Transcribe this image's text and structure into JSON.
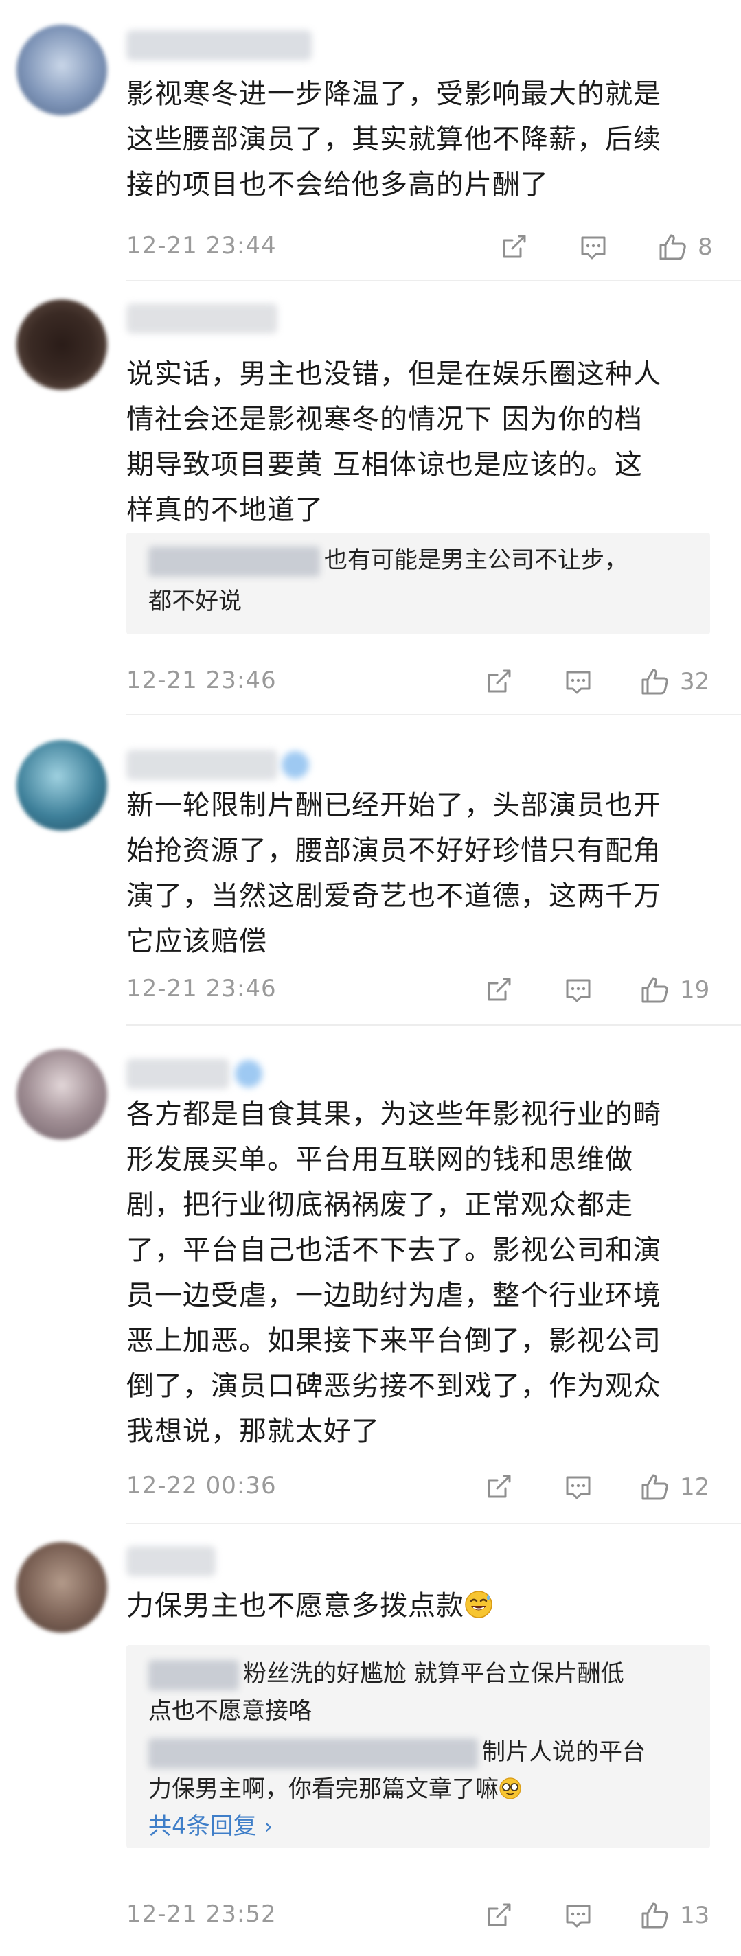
{
  "comments": [
    {
      "text": "影视寒冬进一步降温了，受影响最大的就是\n这些腰部演员了，其实就算他不降薪，后续\n接的项目也不会给他多高的片酬了",
      "time": "12-21 23:44",
      "likes": "8"
    },
    {
      "text": "说实话，男主也没错，但是在娱乐圈这种人\n情社会还是影视寒冬的情况下 因为你的档\n期导致项目要黄 互相体谅也是应该的。这\n样真的不地道了",
      "reply_1": "也有可能是男主公司不让步，",
      "reply_1b": "都不好说",
      "time": "12-21 23:46",
      "likes": "32"
    },
    {
      "text": "新一轮限制片酬已经开始了，头部演员也开\n始抢资源了，腰部演员不好好珍惜只有配角\n演了，当然这剧爱奇艺也不道德，这两千万\n它应该赔偿",
      "time": "12-21 23:46",
      "likes": "19"
    },
    {
      "text": "各方都是自食其果，为这些年影视行业的畸\n形发展买单。平台用互联网的钱和思维做\n剧，把行业彻底祸祸废了，正常观众都走\n了，平台自己也活不下去了。影视公司和演\n员一边受虐，一边助纣为虐，整个行业环境\n恶上加恶。如果接下来平台倒了，影视公司\n倒了，演员口碑恶劣接不到戏了，作为观众\n我想说，那就太好了",
      "time": "12-22 00:36",
      "likes": "12"
    },
    {
      "text": "力保男主也不愿意多拨点款",
      "emoji": "sweat-smile-emoji",
      "reply_1": "粉丝洗的好尴尬 就算平台立保片酬低",
      "reply_1b": "点也不愿意接咯",
      "reply_2": "制片人说的平台",
      "reply_2b": "力保男主啊，你看完那篇文章了嘛",
      "reply_2_emoji": "glasses-emoji",
      "more_replies": "共4条回复",
      "time": "12-21 23:52",
      "likes": "13"
    }
  ],
  "colors": {
    "text": "#1b1b1b",
    "meta": "#9a9a9a",
    "link": "#3f7ec8",
    "reply_bg": "#f4f4f4"
  }
}
